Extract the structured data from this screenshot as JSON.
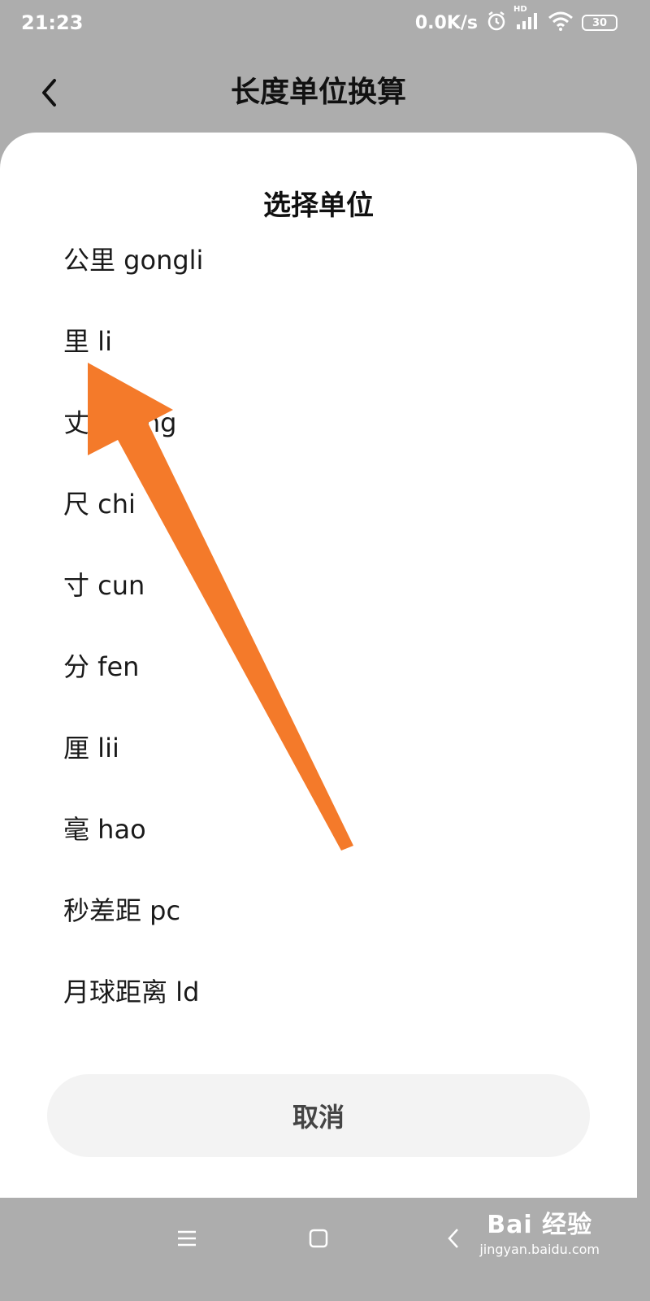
{
  "status_bar": {
    "time": "21:23",
    "speed": "0.0K/s",
    "network": "HD",
    "battery": "30"
  },
  "header": {
    "title": "长度单位换算"
  },
  "sheet": {
    "title": "选择单位",
    "units": [
      {
        "label": "公里 gongli"
      },
      {
        "label": "里 li"
      },
      {
        "label": "丈 zhang"
      },
      {
        "label": "尺 chi"
      },
      {
        "label": "寸 cun"
      },
      {
        "label": "分 fen"
      },
      {
        "label": "厘 lii"
      },
      {
        "label": "毫 hao"
      },
      {
        "label": "秒差距 pc"
      },
      {
        "label": "月球距离 ld"
      }
    ],
    "cancel_label": "取消"
  },
  "annotation": {
    "arrow_color": "#f47a2a"
  },
  "watermark": {
    "brand": "Bai 经验",
    "url": "jingyan.baidu.com"
  }
}
